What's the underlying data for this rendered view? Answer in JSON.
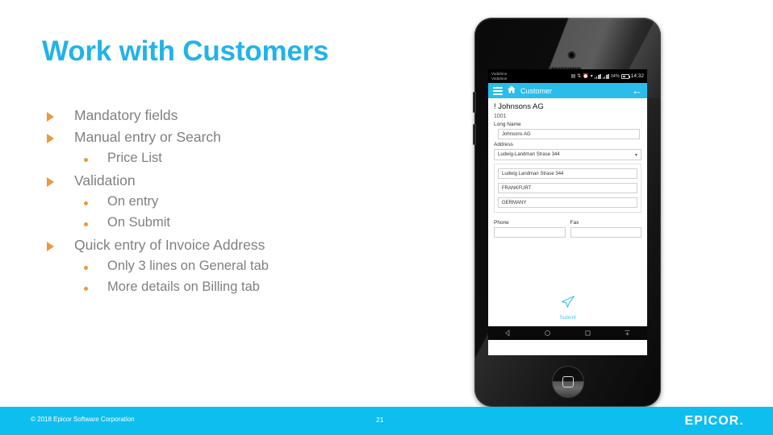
{
  "slide": {
    "title": "Work with Customers",
    "title_color": "#22B3E8",
    "bullet_color": "#E89A3C",
    "text_color": "#808080"
  },
  "bullets": [
    {
      "level": 1,
      "text": "Mandatory fields"
    },
    {
      "level": 1,
      "text": "Manual entry or Search"
    },
    {
      "level": 2,
      "text": "Price List"
    },
    {
      "level": 1,
      "text": "Validation"
    },
    {
      "level": 2,
      "text": "On entry"
    },
    {
      "level": 2,
      "text": "On Submit"
    },
    {
      "level": 1,
      "text": "Quick entry of Invoice Address"
    },
    {
      "level": 2,
      "text": "Only 3 lines on General tab"
    },
    {
      "level": 2,
      "text": "More details on Billing tab"
    }
  ],
  "phone": {
    "status_bar": {
      "carrier": "Vodafone\nVodafone",
      "battery_percent": "34%",
      "time": "14:32"
    },
    "app_bar": {
      "menu_icon": "hamburger-icon",
      "home_icon": "house-icon",
      "title": "Customer",
      "back_icon": "back-arrow-icon"
    },
    "form": {
      "customer_name": "! Johnsons AG",
      "customer_id": "1001",
      "long_name_label": "Long Name",
      "long_name_value": "Johnsons AG",
      "address_label": "Address",
      "address_select_value": "Ludwig-Landman Strase 344",
      "address_line1": "Ludwig Landman Strase 344",
      "address_line2": "FRANKFURT",
      "address_line3": "GERMANY",
      "phone_label": "Phone",
      "phone_value": "",
      "fax_label": "Fax",
      "fax_value": "",
      "submit_label": "Submit",
      "accent_color": "#2BBDEA"
    },
    "nav_bar": {
      "back": "nav-back-icon",
      "home": "nav-home-icon",
      "recents": "nav-recents-icon",
      "hide_keyboard": "nav-hide-keyboard-icon"
    }
  },
  "footer": {
    "copyright": "© 2018 Epicor Software Corporation",
    "page_number": "21",
    "logo": "EPICOR",
    "logo_dot": ".",
    "bar_color": "#0EBEEF"
  }
}
